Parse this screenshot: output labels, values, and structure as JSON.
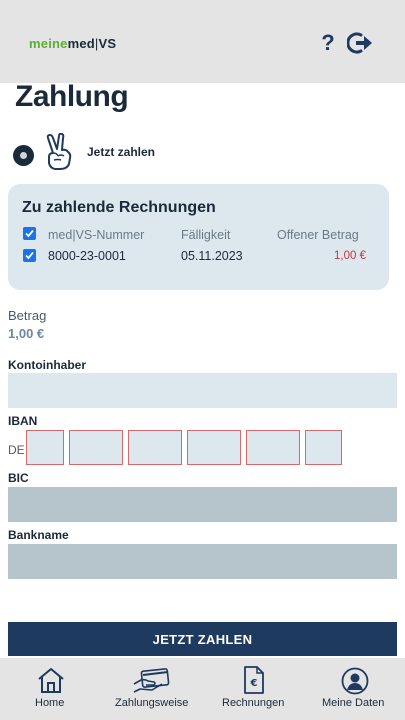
{
  "header": {
    "logo": {
      "part1": "meine",
      "part2": "med",
      "separator": "|",
      "part3": "VS"
    },
    "help_label": "?"
  },
  "page": {
    "title": "Zahlung"
  },
  "payment_method": {
    "label": "Jetzt zahlen",
    "selected": true
  },
  "invoices": {
    "title": "Zu zahlende Rechnungen",
    "columns": [
      "med|VS-Nummer",
      "Fälligkeit",
      "Offener Betrag"
    ],
    "rows": [
      {
        "number": "8000-23-0001",
        "due": "05.11.2023",
        "amount": "1,00 €",
        "checked": true
      }
    ]
  },
  "amount": {
    "label": "Betrag",
    "value": "1,00 €"
  },
  "form": {
    "holder_label": "Kontoinhaber",
    "holder_value": "",
    "iban_label": "IBAN",
    "iban_prefix": "DE",
    "bic_label": "BIC",
    "bic_value": "",
    "bank_label": "Bankname",
    "bank_value": ""
  },
  "pay_button": "JETZT ZAHLEN",
  "nav": {
    "home": "Home",
    "payment": "Zahlungsweise",
    "invoices": "Rechnungen",
    "profile": "Meine Daten"
  },
  "colors": {
    "brand_green": "#5ab031",
    "navy": "#1e3a5f",
    "card_bg": "#dde7ee",
    "amount_red": "#d0323a"
  }
}
